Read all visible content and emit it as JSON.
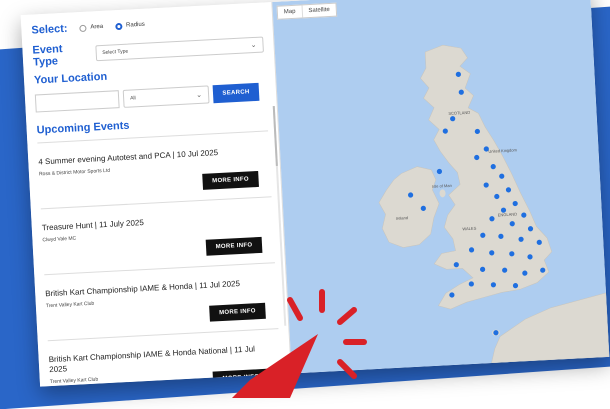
{
  "form": {
    "select_label": "Select:",
    "radio_area": "Area",
    "radio_radius": "Radius",
    "event_type_label": "Event Type",
    "event_type_value": "Select Type",
    "location_label": "Your Location",
    "location_value": "",
    "radius_select": "All",
    "search_label": "SEARCH"
  },
  "upcoming_title": "Upcoming Events",
  "events": [
    {
      "title": "4 Summer evening Autotest and PCA | 10 Jul 2025",
      "org": "Ross & District Motor Sports Ltd",
      "button": "MORE INFO"
    },
    {
      "title": "Treasure Hunt | 11 July 2025",
      "org": "Clwyd Vale MC",
      "button": "MORE INFO"
    },
    {
      "title": "British Kart Championship IAME & Honda | 11 Jul 2025",
      "org": "Trent Valley Kart Club",
      "button": "MORE INFO"
    },
    {
      "title": "British Kart Championship IAME & Honda National | 11 Jul 2025",
      "org": "Trent Valley Kart Club",
      "button": "MORE INFO"
    }
  ],
  "map": {
    "tab_map": "Map",
    "tab_satellite": "Satellite",
    "labels": {
      "scotland": "SCOTLAND",
      "united_kingdom": "United Kingdom",
      "isle_of_man": "Isle of Man",
      "ireland": "Ireland",
      "wales": "WALES",
      "england": "ENGLAND"
    },
    "water_color": "#aecdf0",
    "land_color": "#dcd9d1",
    "marker_color": "#1f6fe0"
  },
  "colors": {
    "accent": "#1f5fd1",
    "background_band": "#2a66c8",
    "pointer_arrow": "#d92127"
  }
}
